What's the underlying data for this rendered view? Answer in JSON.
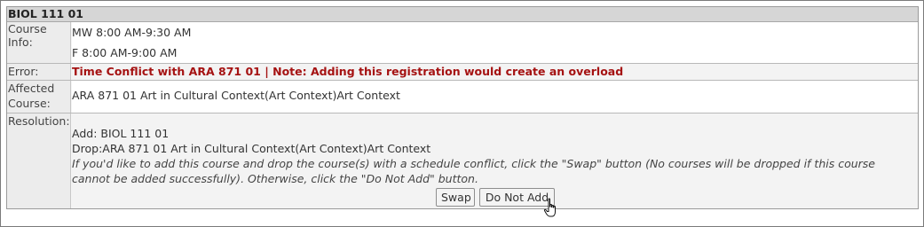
{
  "section": {
    "title": "BIOL 111 01"
  },
  "course_info": {
    "label": "Course Info:",
    "line1": "MW  8:00 AM-9:30 AM",
    "line2": "F  8:00 AM-9:00 AM"
  },
  "error": {
    "label": "Error:",
    "text": "Time Conflict with ARA 871 01 | Note: Adding this registration would create an overload"
  },
  "affected": {
    "label_line1": "Affected",
    "label_line2": "Course:",
    "text": "ARA 871 01 Art in Cultural Context(Art Context)Art Context"
  },
  "resolution": {
    "label": "Resolution:",
    "add_line": "Add:  BIOL 111 01",
    "drop_line": "Drop:ARA 871 01 Art in Cultural Context(Art Context)Art Context",
    "instructions": "If you'd like to add this course and drop the course(s) with a schedule conflict, click the \"Swap\" button (No courses will be dropped if this course cannot be added successfully). Otherwise, click the \"Do Not Add\" button."
  },
  "buttons": {
    "swap": "Swap",
    "do_not_add": "Do Not Add"
  },
  "colors": {
    "error": "#a51212",
    "header_bg": "#d6d6d6"
  },
  "icons": {
    "cursor": "hand-pointer-icon"
  }
}
